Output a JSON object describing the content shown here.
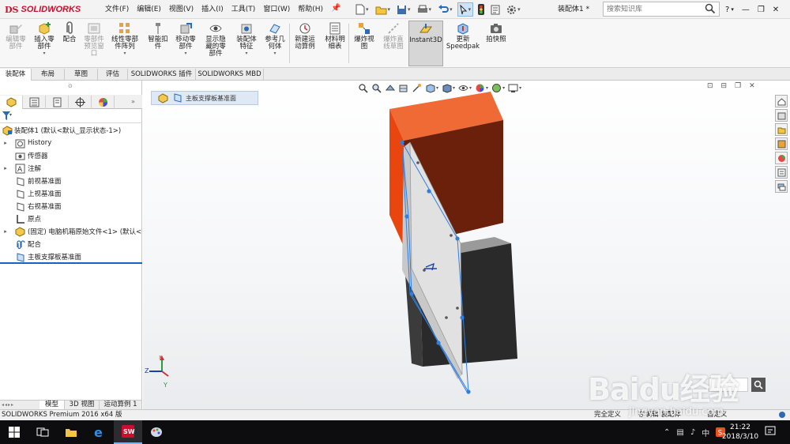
{
  "app": {
    "logo_text": "SOLIDWORKS",
    "document_title": "装配体1 *"
  },
  "menus": [
    "文件(F)",
    "编辑(E)",
    "视图(V)",
    "插入(I)",
    "工具(T)",
    "窗口(W)",
    "帮助(H)"
  ],
  "search": {
    "placeholder": "搜索知识库"
  },
  "commands": [
    {
      "label": "编辑零\n部件",
      "icon": "edit-component-icon",
      "enabled": false
    },
    {
      "label": "插入零\n部件",
      "icon": "insert-component-icon",
      "enabled": true
    },
    {
      "label": "配合",
      "icon": "mate-icon",
      "enabled": true
    },
    {
      "label": "零部件\n预览窗\n口",
      "icon": "component-preview-icon",
      "enabled": false
    },
    {
      "label": "线性零部\n件阵列",
      "icon": "linear-pattern-icon",
      "enabled": true
    },
    {
      "label": "智能扣\n件",
      "icon": "smart-fasteners-icon",
      "enabled": true
    },
    {
      "label": "移动零\n部件",
      "icon": "move-component-icon",
      "enabled": true
    },
    {
      "label": "显示隐\n藏的零\n部件",
      "icon": "show-hidden-icon",
      "enabled": true
    },
    {
      "label": "装配体\n特征",
      "icon": "assembly-features-icon",
      "enabled": true
    },
    {
      "label": "参考几\n何体",
      "icon": "reference-geometry-icon",
      "enabled": true
    },
    {
      "label": "新建运\n动算例",
      "icon": "new-motion-study-icon",
      "enabled": true
    },
    {
      "label": "材料明\n细表",
      "icon": "bom-icon",
      "enabled": true
    },
    {
      "label": "爆炸视\n图",
      "icon": "exploded-view-icon",
      "enabled": true
    },
    {
      "label": "爆炸直\n线草图",
      "icon": "explode-line-sketch-icon",
      "enabled": false
    },
    {
      "label": "Instant3D",
      "icon": "instant3d-icon",
      "enabled": true,
      "active": true
    },
    {
      "label": "更新\nSpeedpak",
      "icon": "speedpak-icon",
      "enabled": true
    },
    {
      "label": "拍快照",
      "icon": "snapshot-icon",
      "enabled": true
    }
  ],
  "tabs": [
    "装配体",
    "布局",
    "草图",
    "评估",
    "SOLIDWORKS 插件",
    "SOLIDWORKS MBD"
  ],
  "tree": [
    {
      "label": "装配体1  (默认<默认_显示状态-1>)",
      "icon": "assembly-icon",
      "expander": ""
    },
    {
      "label": "History",
      "icon": "history-icon",
      "expander": "▸"
    },
    {
      "label": "传感器",
      "icon": "sensor-icon",
      "expander": ""
    },
    {
      "label": "注解",
      "icon": "annotation-icon",
      "expander": "▸"
    },
    {
      "label": "前视基准面",
      "icon": "plane-icon",
      "expander": ""
    },
    {
      "label": "上视基准面",
      "icon": "plane-icon",
      "expander": ""
    },
    {
      "label": "右视基准面",
      "icon": "plane-icon",
      "expander": ""
    },
    {
      "label": "原点",
      "icon": "origin-icon",
      "expander": ""
    },
    {
      "label": "(固定) 电脑机箱原始文件<1> (默认<",
      "icon": "part-icon",
      "expander": "▸"
    },
    {
      "label": "配合",
      "icon": "mates-folder-icon",
      "expander": ""
    },
    {
      "label": "主板支撑板基准面",
      "icon": "plane-icon",
      "expander": ""
    }
  ],
  "bottom_tabs": [
    "模型",
    "3D 视图",
    "运动算例 1"
  ],
  "breadcrumb": {
    "label": "主板支撑板基准面"
  },
  "status": {
    "left": "SOLIDWORKS Premium 2016 x64 版",
    "seg1": "完全定义",
    "seg2": "在编辑 装配体",
    "seg3": "自定义"
  },
  "clock": {
    "time": "21:22",
    "date": "2018/3/10"
  },
  "tray": {
    "ime": "中"
  },
  "watermark": {
    "logo": "Baidu经验",
    "url": "jingyan.baidu.com"
  },
  "triad": {
    "y": "Y",
    "z": "Z"
  },
  "colors": {
    "accent": "#1565c0",
    "block_orange_front": "#e8450f",
    "block_orange_side": "#6b200c",
    "block_dark_front": "#333333",
    "block_dark_side": "#1f1f1f",
    "plate": "#dcdcdc",
    "sketch_blue": "#2f7fe0"
  }
}
